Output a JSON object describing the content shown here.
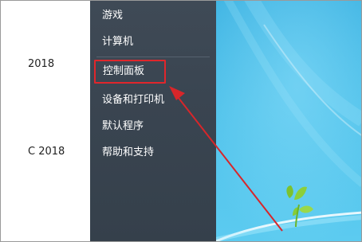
{
  "left_pane": {
    "date_1": "2018",
    "date_2": "C 2018"
  },
  "start_menu": {
    "items": [
      {
        "label": "游戏"
      },
      {
        "label": "计算机"
      },
      {
        "label": "控制面板"
      },
      {
        "label": "设备和打印机"
      },
      {
        "label": "默认程序"
      },
      {
        "label": "帮助和支持"
      }
    ]
  },
  "annotation": {
    "highlight_color": "#e0262b",
    "arrow_color": "#d8262a"
  },
  "colors": {
    "menu_bg": "#3a4551",
    "desktop_blue": "#4ec1ea"
  }
}
